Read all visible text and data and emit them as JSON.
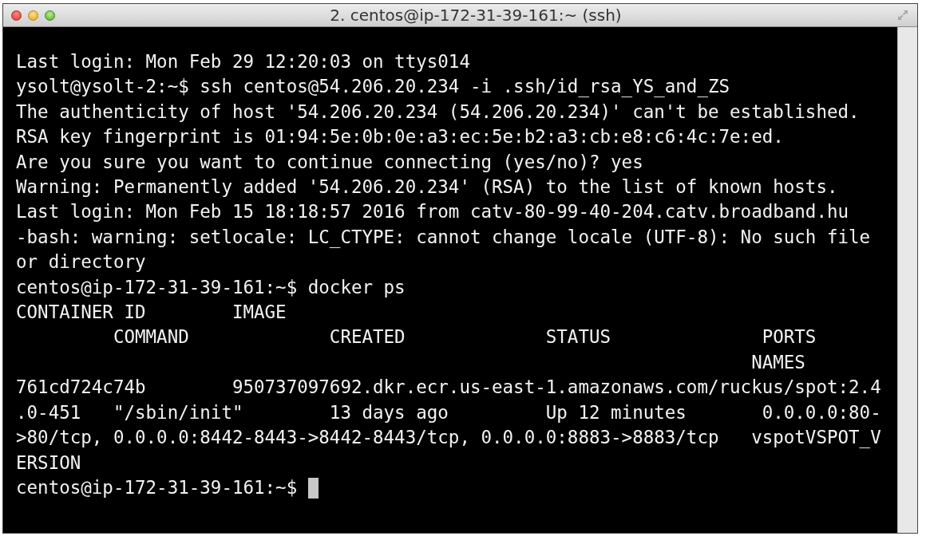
{
  "window": {
    "title": "2. centos@ip-172-31-39-161:~ (ssh)"
  },
  "terminal": {
    "lines": [
      "Last login: Mon Feb 29 12:20:03 on ttys014",
      "ysolt@ysolt-2:~$ ssh centos@54.206.20.234 -i .ssh/id_rsa_YS_and_ZS",
      "The authenticity of host '54.206.20.234 (54.206.20.234)' can't be established.",
      "RSA key fingerprint is 01:94:5e:0b:0e:a3:ec:5e:b2:a3:cb:e8:c6:4c:7e:ed.",
      "Are you sure you want to continue connecting (yes/no)? yes",
      "Warning: Permanently added '54.206.20.234' (RSA) to the list of known hosts.",
      "Last login: Mon Feb 15 18:18:57 2016 from catv-80-99-40-204.catv.broadband.hu",
      "-bash: warning: setlocale: LC_CTYPE: cannot change locale (UTF-8): No such file",
      "or directory",
      "centos@ip-172-31-39-161:~$ docker ps",
      "CONTAINER ID        IMAGE",
      "         COMMAND             CREATED             STATUS              PORTS",
      "                                                                    NAMES",
      "761cd724c74b        950737097692.dkr.ecr.us-east-1.amazonaws.com/ruckus/spot:2.4",
      ".0-451   \"/sbin/init\"        13 days ago         Up 12 minutes       0.0.0.0:80-",
      ">80/tcp, 0.0.0.0:8442-8443->8442-8443/tcp, 0.0.0.0:8883->8883/tcp   vspotVSPOT_V",
      "ERSION",
      "centos@ip-172-31-39-161:~$"
    ]
  }
}
